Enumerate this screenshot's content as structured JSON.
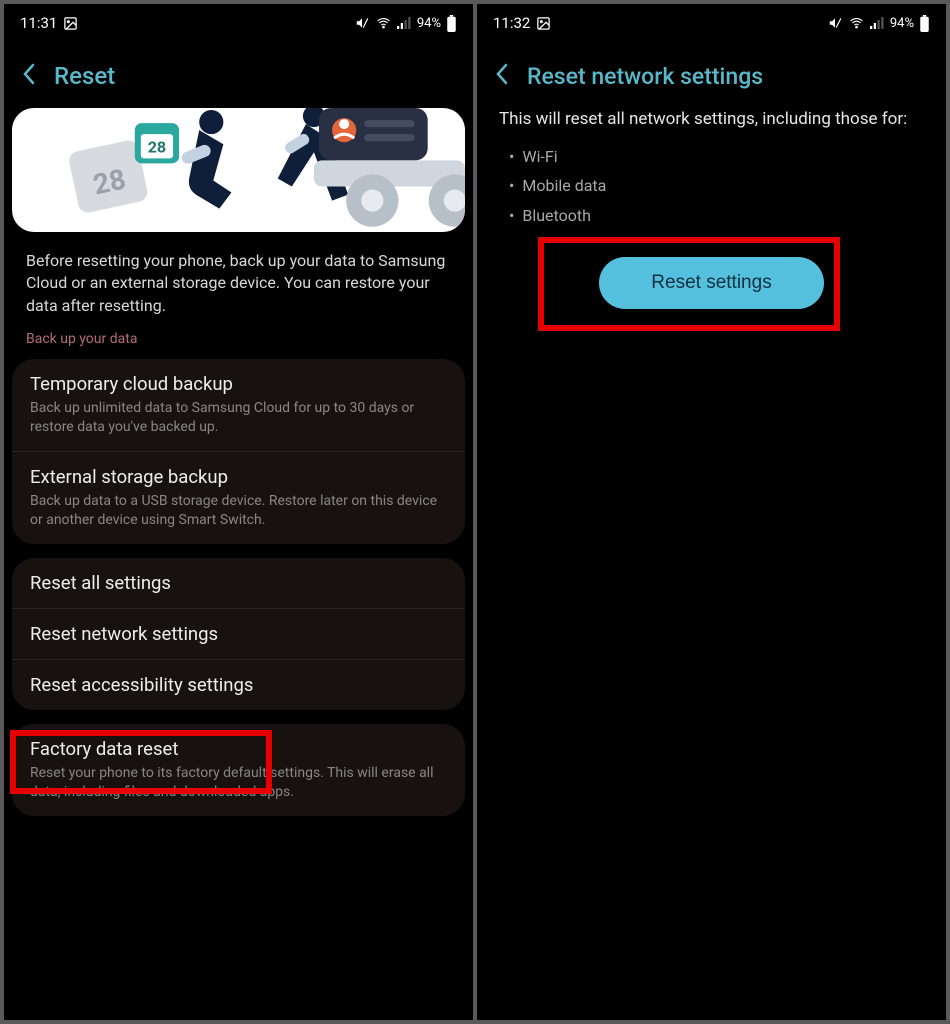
{
  "left": {
    "status": {
      "time": "11:31",
      "battery": "94%"
    },
    "title": "Reset",
    "calendarDay": "28",
    "intro": "Before resetting your phone, back up your data to Samsung Cloud or an external storage device. You can restore your data after resetting.",
    "backupLabel": "Back up your data",
    "backup": [
      {
        "title": "Temporary cloud backup",
        "sub": "Back up unlimited data to Samsung Cloud for up to 30 days or restore data you've backed up."
      },
      {
        "title": "External storage backup",
        "sub": "Back up data to a USB storage device. Restore later on this device or another device using Smart Switch."
      }
    ],
    "resets": [
      {
        "title": "Reset all settings"
      },
      {
        "title": "Reset network settings"
      },
      {
        "title": "Reset accessibility settings"
      }
    ],
    "factory": {
      "title": "Factory data reset",
      "sub": "Reset your phone to its factory default settings. This will erase all data, including files and downloaded apps."
    }
  },
  "right": {
    "status": {
      "time": "11:32",
      "battery": "94%"
    },
    "title": "Reset network settings",
    "desc": "This will reset all network settings, including those for:",
    "bullets": [
      "Wi-Fi",
      "Mobile data",
      "Bluetooth"
    ],
    "cta": "Reset settings"
  }
}
